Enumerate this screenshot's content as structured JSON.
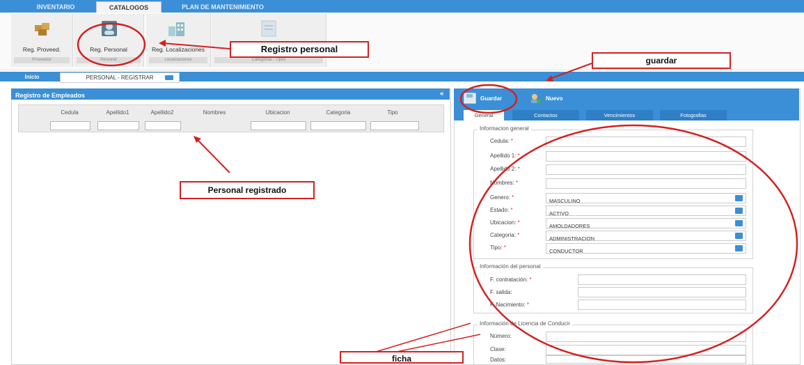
{
  "top_tabs": [
    "INVENTARIO",
    "CATALOGOS",
    "PLAN DE MANTENIMIENTO"
  ],
  "ribbon": {
    "buttons": [
      {
        "label": "Reg. Proveed.",
        "group": "Proveedor"
      },
      {
        "label": "Reg. Personal",
        "group": "Personal"
      },
      {
        "label": "Reg. Localizaciones",
        "group": "Localizaciones"
      },
      {
        "label": "",
        "group": "Categorias - Tipos"
      }
    ]
  },
  "page_tabs": {
    "home": "Inicio",
    "current": "PERSONAL - REGISTRAR"
  },
  "left_panel": {
    "title": "Registro de Empleados",
    "columns": [
      "Cedula",
      "Apellido1",
      "Apellido2",
      "Nombres",
      "Ubicacion",
      "Categoria",
      "Tipo"
    ]
  },
  "right_panel": {
    "toolbar": {
      "save": "Guardar",
      "new": "Nuevo"
    },
    "tabs": [
      "General",
      "Contactos",
      "Vencimientos",
      "Fotografias"
    ],
    "general_info": {
      "legend": "Informacion general",
      "fields": [
        {
          "label": "Cedula:",
          "value": ""
        },
        {
          "label": "Apellido 1:",
          "value": ""
        },
        {
          "label": "Apellido 2:",
          "value": ""
        },
        {
          "label": "Nombres:",
          "value": ""
        }
      ],
      "selects": [
        {
          "label": "Genero:",
          "value": "MASCULINO"
        },
        {
          "label": "Estado:",
          "value": "ACTIVO"
        },
        {
          "label": "Ubicacion:",
          "value": "AMOLDADORES"
        },
        {
          "label": "Categoria:",
          "value": "ADMINISTRACION"
        },
        {
          "label": "Tipo:",
          "value": "CONDUCTOR"
        }
      ]
    },
    "personal_info": {
      "legend": "Información del personal",
      "fields": [
        {
          "label": "F. contratación:"
        },
        {
          "label": "F. salida:"
        },
        {
          "label": "F. Nacimiento:"
        }
      ]
    },
    "license_info": {
      "legend": "Información de Licencia de Conducir",
      "fields": [
        {
          "label": "Número:"
        },
        {
          "label": "Clase:"
        },
        {
          "label": "Datos:"
        }
      ]
    }
  },
  "annotations": {
    "registro": "Registro personal",
    "guardar": "guardar",
    "registrado": "Personal registrado",
    "ficha": "ficha"
  },
  "colors": {
    "accent": "#3b8fd6",
    "annotation": "#d42020"
  }
}
